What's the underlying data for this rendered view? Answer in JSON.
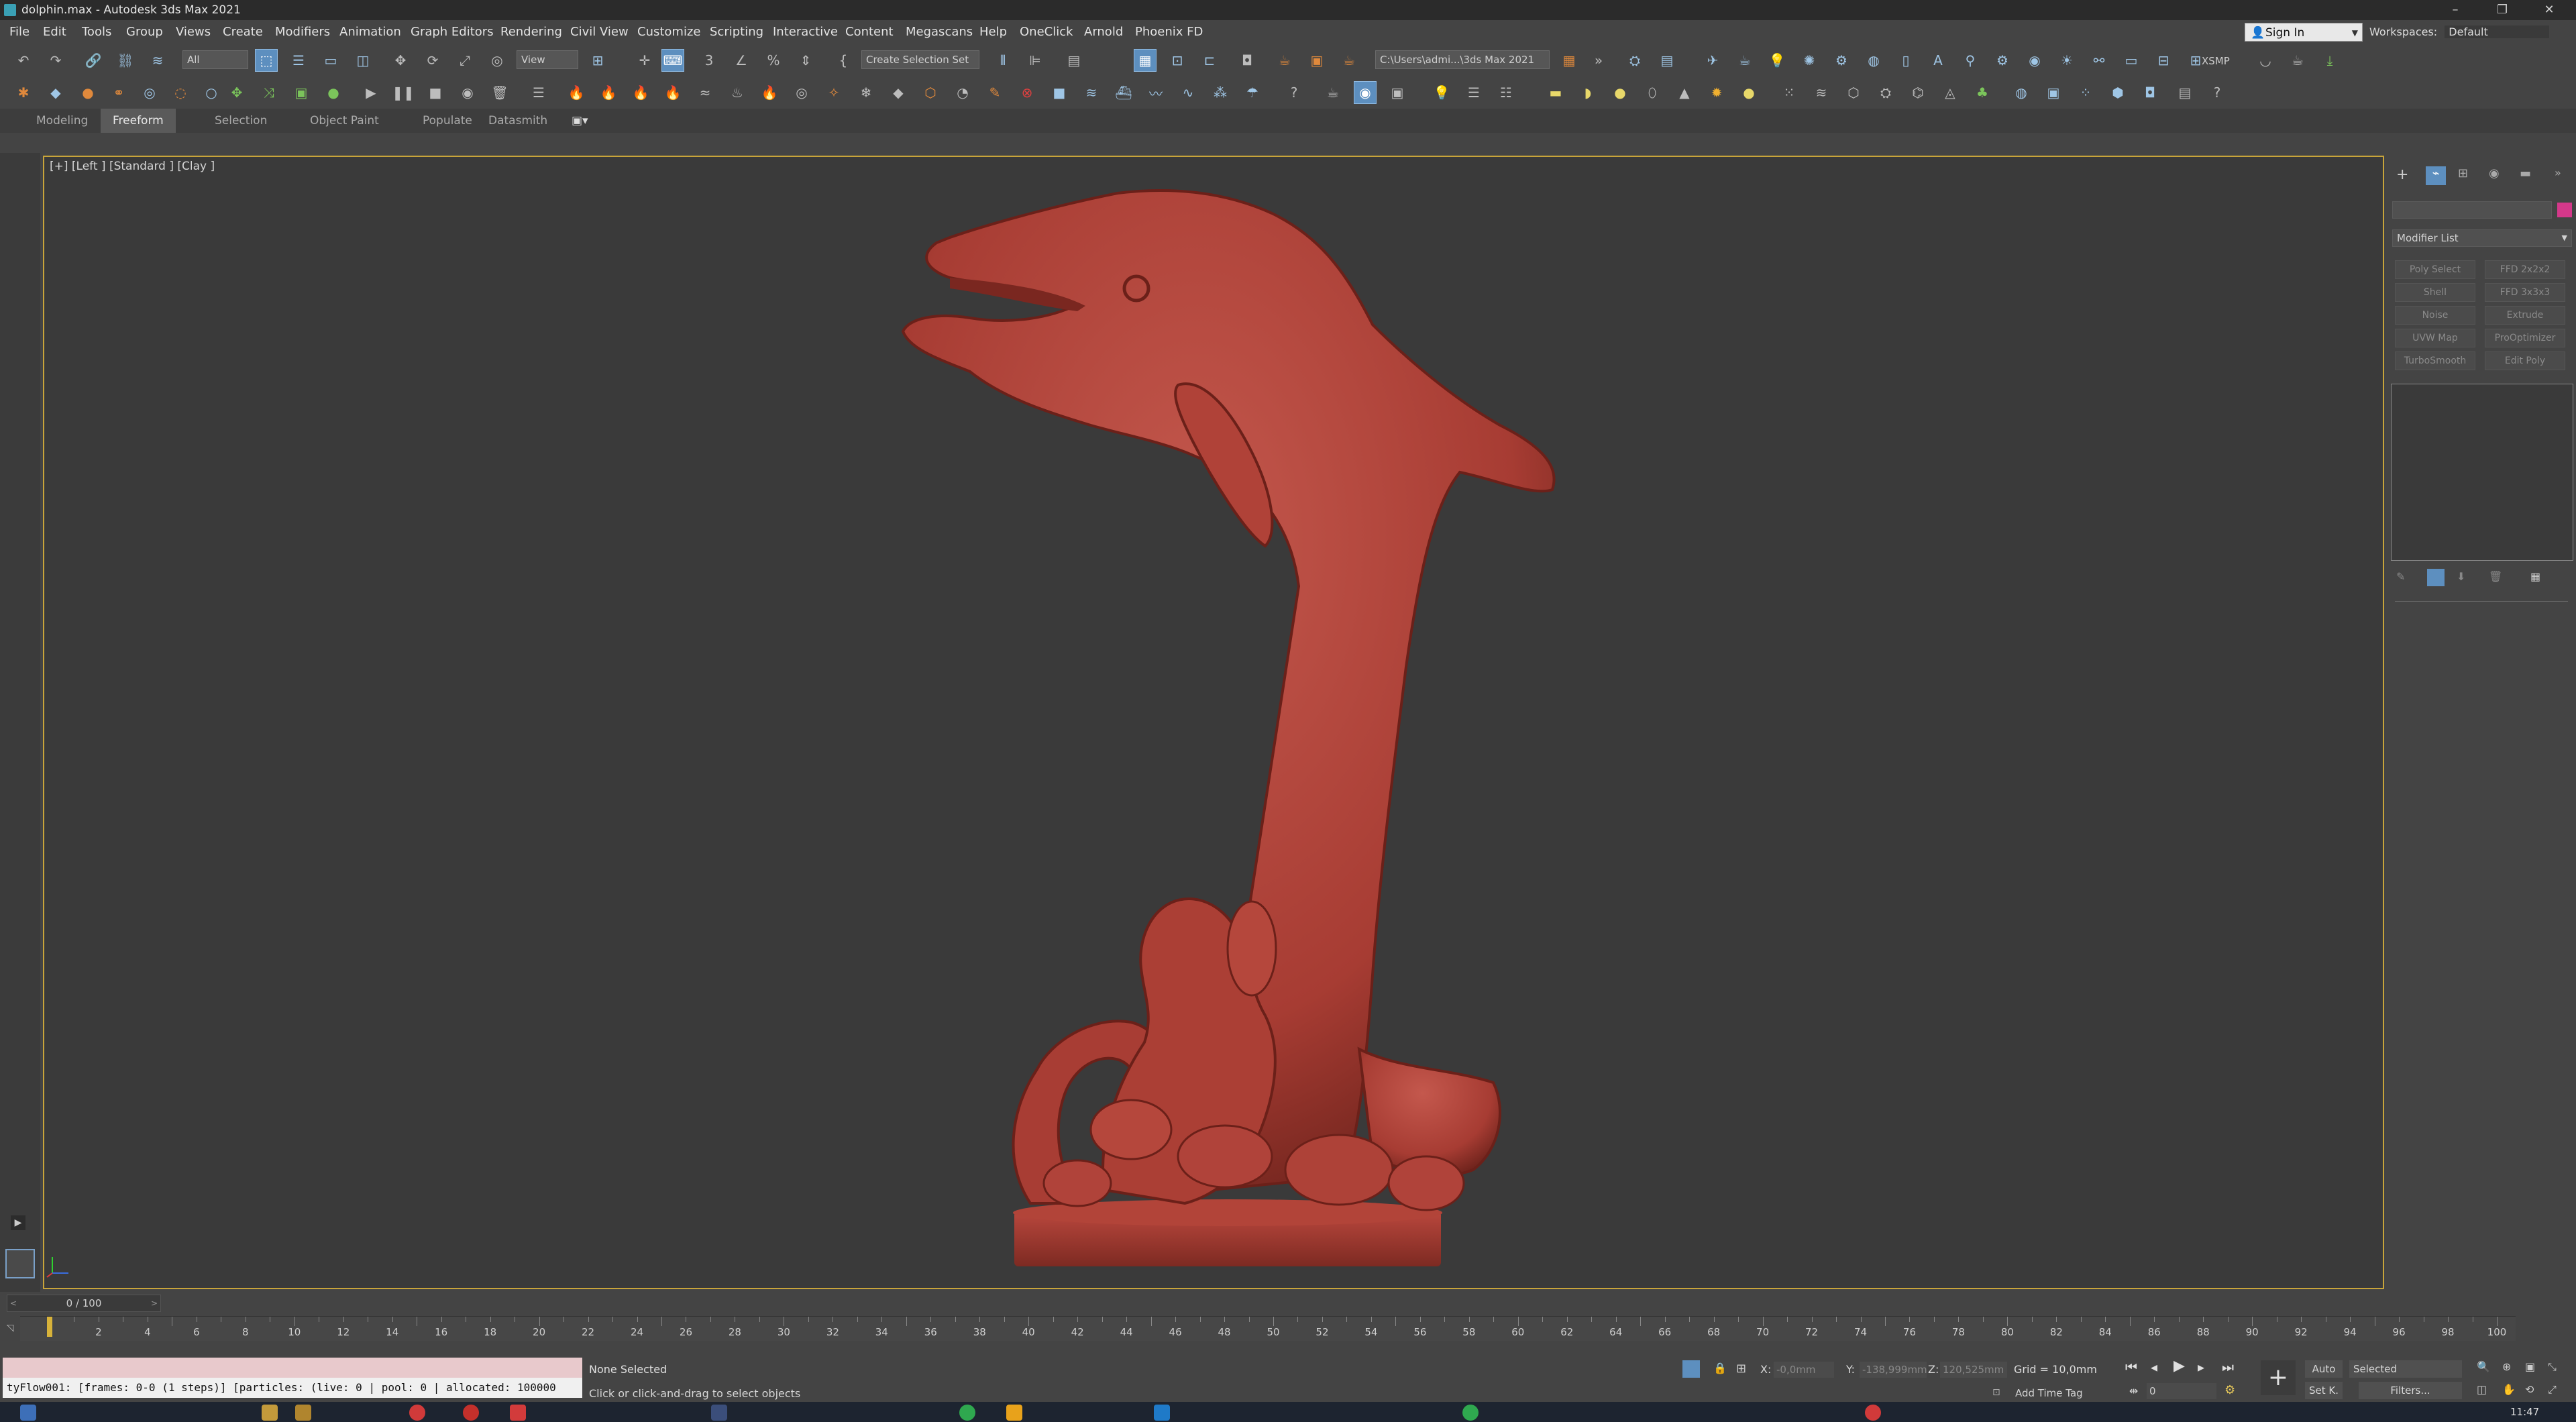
{
  "window": {
    "title": "dolphin.max - Autodesk 3ds Max 2021",
    "controls": [
      "–",
      "❐",
      "✕"
    ]
  },
  "menu": [
    "File",
    "Edit",
    "Tools",
    "Group",
    "Views",
    "Create",
    "Modifiers",
    "Animation",
    "Graph Editors",
    "Rendering",
    "Civil View",
    "Customize",
    "Scripting",
    "Interactive",
    "Content",
    "Megascans",
    "Help",
    "OneClick",
    "Arnold",
    "Phoenix FD"
  ],
  "account": {
    "sign_in": "Sign In",
    "workspaces_label": "Workspaces:",
    "workspace_value": "Default"
  },
  "toolbar": {
    "selection_filter": "All",
    "reference_coord": "View",
    "named_selection": "Create Selection Set",
    "project_path": "C:\\Users\\admi...\\3ds Max 2021",
    "xsmp_label": "XSMP"
  },
  "ribbon": {
    "tabs": [
      "Modeling",
      "Freeform",
      "Selection",
      "Object Paint",
      "Populate",
      "Datasmith"
    ],
    "active": "Freeform"
  },
  "viewport": {
    "label": "[+] [Left ] [Standard ] [Clay ]",
    "model_color": "#b4473d"
  },
  "command_panel": {
    "modifier_list": "Modifier List",
    "buttons": [
      "Poly Select",
      "FFD 2x2x2",
      "Shell",
      "FFD 3x3x3",
      "Noise",
      "Extrude",
      "UVW Map",
      "ProOptimizer",
      "TurboSmooth",
      "Edit Poly"
    ]
  },
  "timeline": {
    "frame_display": "0 / 100",
    "ticks": [
      "0",
      "2",
      "4",
      "6",
      "8",
      "10",
      "12",
      "14",
      "16",
      "18",
      "20",
      "22",
      "24",
      "26",
      "28",
      "30",
      "32",
      "34",
      "36",
      "38",
      "40",
      "42",
      "44",
      "46",
      "48",
      "50",
      "52",
      "54",
      "56",
      "58",
      "60",
      "62",
      "64",
      "66",
      "68",
      "70",
      "72",
      "74",
      "76",
      "78",
      "80",
      "82",
      "84",
      "86",
      "88",
      "90",
      "92",
      "94",
      "96",
      "98",
      "100"
    ]
  },
  "status": {
    "maxscript_output": "tyFlow001: [frames: 0-0 (1 steps)] [particles: (live: 0 | pool: 0 | allocated: 100000",
    "selection_info": "None Selected",
    "prompt": "Click or click-and-drag to select objects",
    "x_label": "X:",
    "x_value": "-0,0mm",
    "y_label": "Y:",
    "y_value": "-138,999mm",
    "z_label": "Z:",
    "z_value": "120,525mm",
    "grid": "Grid = 10,0mm",
    "add_time_tag": "Add Time Tag",
    "auto_key": "Auto",
    "set_key": "Set K.",
    "key_filter": "Selected",
    "filters": "Filters...",
    "current_frame": "0",
    "clock": "11:47"
  }
}
